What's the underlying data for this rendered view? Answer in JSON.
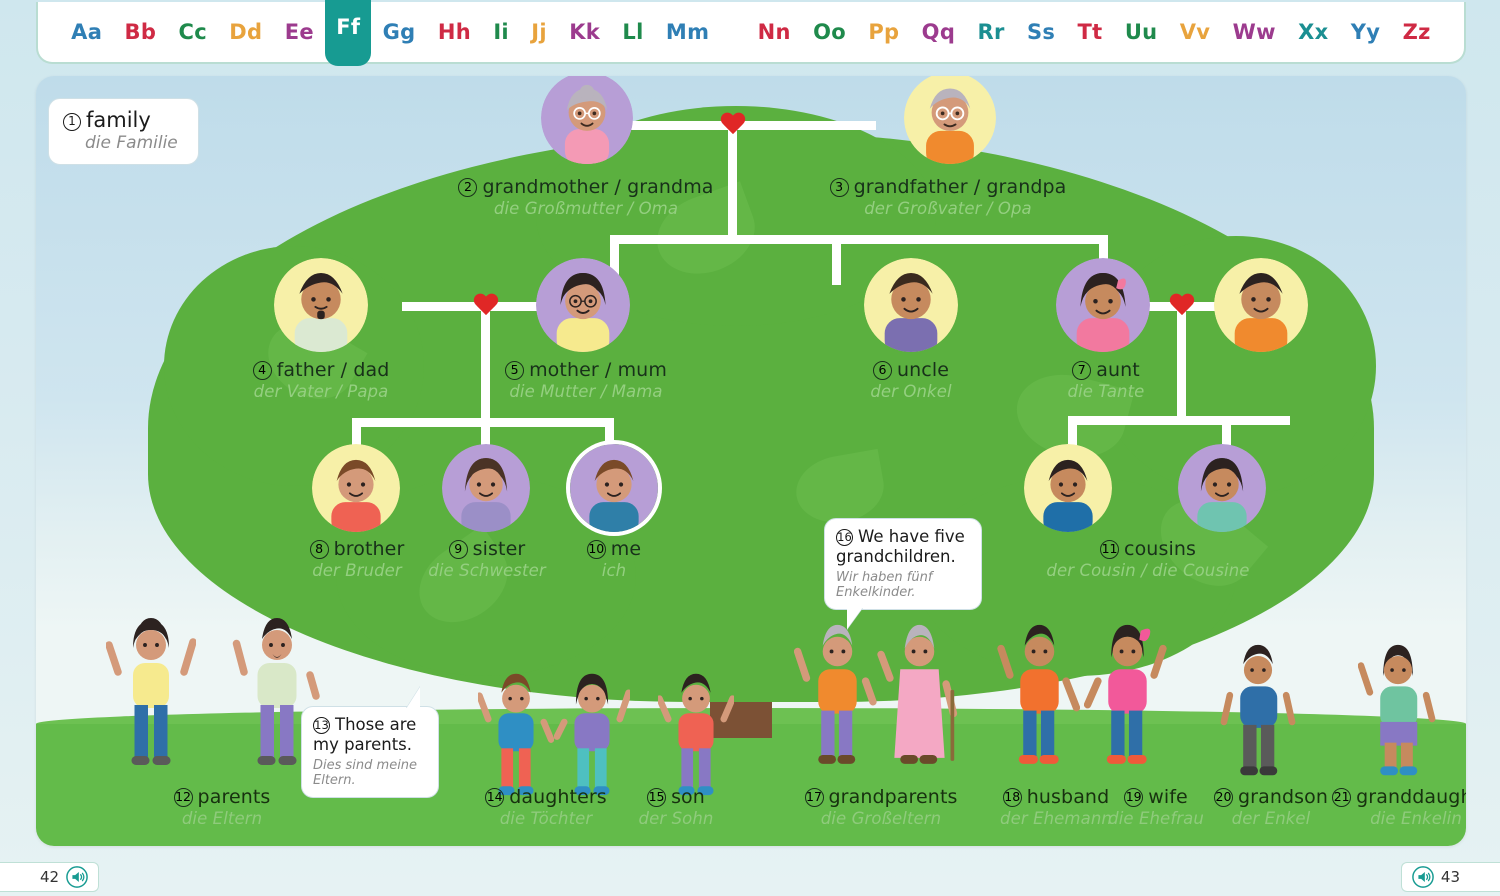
{
  "alphabet": {
    "letters": [
      {
        "label": "Aa",
        "color": "#2f7fb5",
        "active": false
      },
      {
        "label": "Bb",
        "color": "#cf2a44",
        "active": false
      },
      {
        "label": "Cc",
        "color": "#1f8a4c",
        "active": false
      },
      {
        "label": "Dd",
        "color": "#e8a33d",
        "active": false
      },
      {
        "label": "Ee",
        "color": "#9c3b8e",
        "active": false
      },
      {
        "label": "Ff",
        "color": "#ffffff",
        "active": true
      },
      {
        "label": "Gg",
        "color": "#2f7fb5",
        "active": false
      },
      {
        "label": "Hh",
        "color": "#cf2a44",
        "active": false
      },
      {
        "label": "Ii",
        "color": "#1f8a4c",
        "active": false
      },
      {
        "label": "Jj",
        "color": "#e8a33d",
        "active": false
      },
      {
        "label": "Kk",
        "color": "#9c3b8e",
        "active": false
      },
      {
        "label": "Ll",
        "color": "#1f8a4c",
        "active": false
      },
      {
        "label": "Mm",
        "color": "#2f7fb5",
        "active": false
      },
      {
        "label": "Nn",
        "color": "#cf2a44",
        "active": false
      },
      {
        "label": "Oo",
        "color": "#1f8a4c",
        "active": false
      },
      {
        "label": "Pp",
        "color": "#e8a33d",
        "active": false
      },
      {
        "label": "Qq",
        "color": "#9c3b8e",
        "active": false
      },
      {
        "label": "Rr",
        "color": "#1b8f92",
        "active": false
      },
      {
        "label": "Ss",
        "color": "#2f7fb5",
        "active": false
      },
      {
        "label": "Tt",
        "color": "#cf2a44",
        "active": false
      },
      {
        "label": "Uu",
        "color": "#1f8a4c",
        "active": false
      },
      {
        "label": "Vv",
        "color": "#e8a33d",
        "active": false
      },
      {
        "label": "Ww",
        "color": "#9c3b8e",
        "active": false
      },
      {
        "label": "Xx",
        "color": "#1b8f92",
        "active": false
      },
      {
        "label": "Yy",
        "color": "#2f7fb5",
        "active": false
      },
      {
        "label": "Zz",
        "color": "#cf2a44",
        "active": false
      }
    ],
    "active_letter": "Ff",
    "active_bg": "#179b92"
  },
  "title_card": {
    "number": "1",
    "en": "family",
    "de": "die Familie"
  },
  "tree_labels": [
    {
      "number": "2",
      "en": "grandmother / grandma",
      "de": "die Großmutter / Oma"
    },
    {
      "number": "3",
      "en": "grandfather / grandpa",
      "de": "der Großvater / Opa"
    },
    {
      "number": "4",
      "en": "father / dad",
      "de": "der Vater / Papa"
    },
    {
      "number": "5",
      "en": "mother / mum",
      "de": "die Mutter / Mama"
    },
    {
      "number": "6",
      "en": "uncle",
      "de": "der Onkel"
    },
    {
      "number": "7",
      "en": "aunt",
      "de": "die Tante"
    },
    {
      "number": "8",
      "en": "brother",
      "de": "der Bruder"
    },
    {
      "number": "9",
      "en": "sister",
      "de": "die Schwester"
    },
    {
      "number": "10",
      "en": "me",
      "de": "ich"
    },
    {
      "number": "11",
      "en": "cousins",
      "de": "der Cousin / die Cousine"
    }
  ],
  "ground_labels": [
    {
      "number": "12",
      "en": "parents",
      "de": "die Eltern"
    },
    {
      "number": "14",
      "en": "daughters",
      "de": "die Töchter"
    },
    {
      "number": "15",
      "en": "son",
      "de": "der Sohn"
    },
    {
      "number": "17",
      "en": "grandparents",
      "de": "die Großeltern"
    },
    {
      "number": "18",
      "en": "husband",
      "de": "der Ehemann"
    },
    {
      "number": "19",
      "en": "wife",
      "de": "die Ehefrau"
    },
    {
      "number": "20",
      "en": "grandson",
      "de": "der Enkel"
    },
    {
      "number": "21",
      "en": "granddaughter",
      "de": "die Enkelin"
    }
  ],
  "bubbles": [
    {
      "number": "13",
      "en": "Those are my parents.",
      "de": "Dies sind meine Eltern."
    },
    {
      "number": "16",
      "en": "We have five grandchildren.",
      "de": "Wir haben fünf Enkelkinder."
    }
  ],
  "footer": {
    "left_page": "42",
    "right_page": "43",
    "audio_icon": "speaker-icon",
    "accent": "#179b92"
  },
  "colors": {
    "canopy_green": "#5bb03f",
    "ground_green": "#63bb4a",
    "trunk_brown": "#7c5135",
    "heart_red": "#e02726",
    "avatar_purple": "#b79ed6",
    "avatar_yellow": "#f7f0a8",
    "line_white": "#ffffff"
  }
}
